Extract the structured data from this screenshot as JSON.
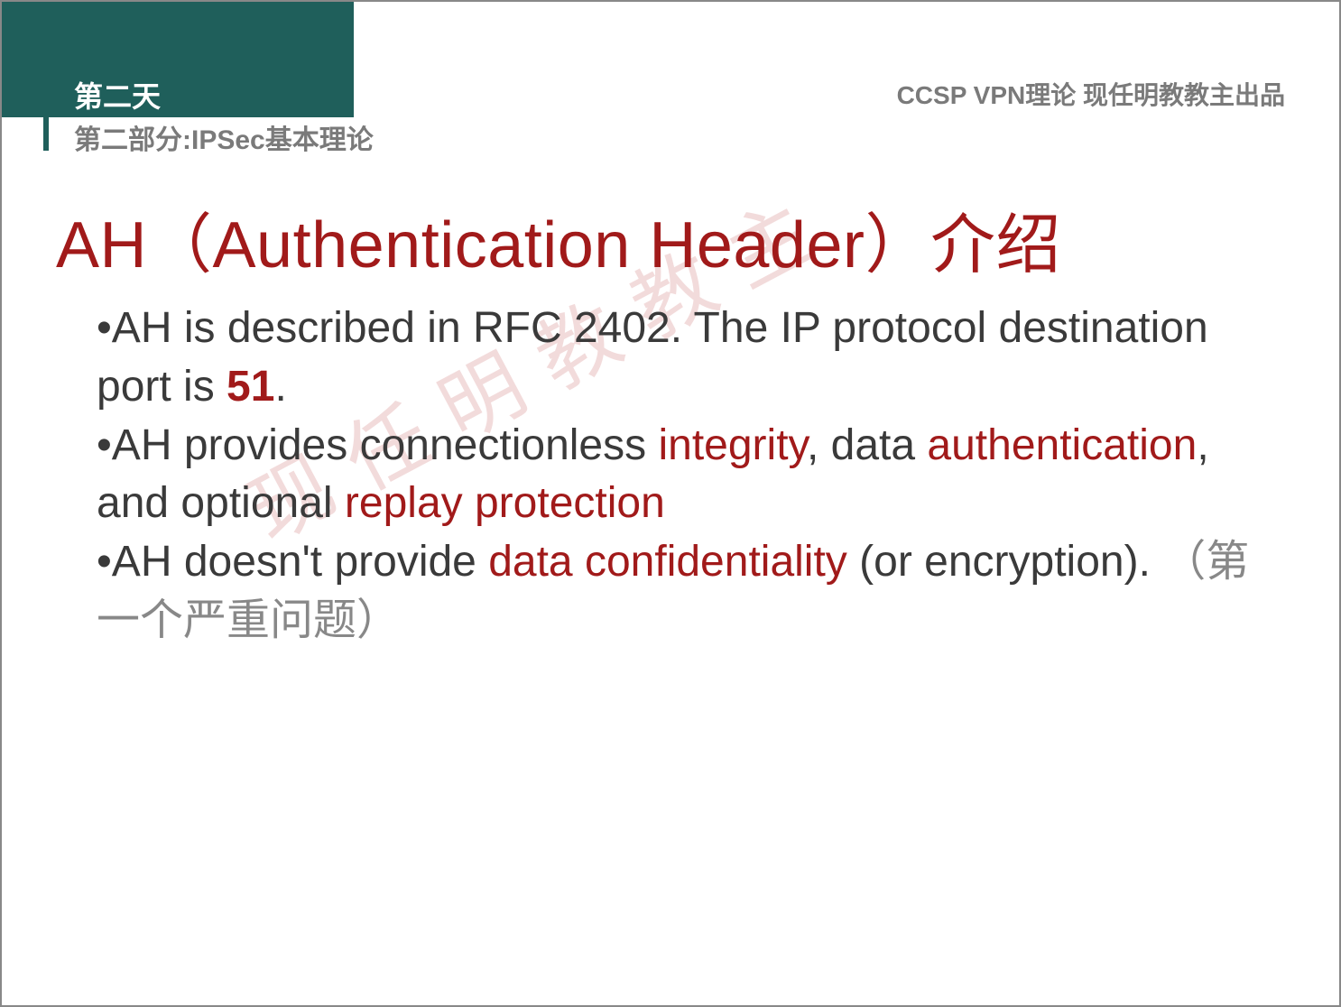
{
  "header": {
    "day": "第二天",
    "section": "第二部分:IPSec基本理论",
    "course": "CCSP VPN理论 现任明教教主出品"
  },
  "title": "AH（Authentication Header）介绍",
  "watermark": "现任明教教主",
  "bullets": {
    "b1_pre": "•AH is described in RFC 2402. The IP protocol destination port is ",
    "b1_bold": "51",
    "b1_post": ".",
    "b2_pre": "•AH provides connectionless ",
    "b2_r1": "integrity",
    "b2_mid1": ", data ",
    "b2_r2": "authentication",
    "b2_mid2": ", and optional ",
    "b2_r3": "replay protection",
    "b3_pre": "•AH doesn't provide ",
    "b3_r1": "data confidentiality",
    "b3_mid": " (or encryption). ",
    "b3_gray": "（第一个严重问题）"
  }
}
